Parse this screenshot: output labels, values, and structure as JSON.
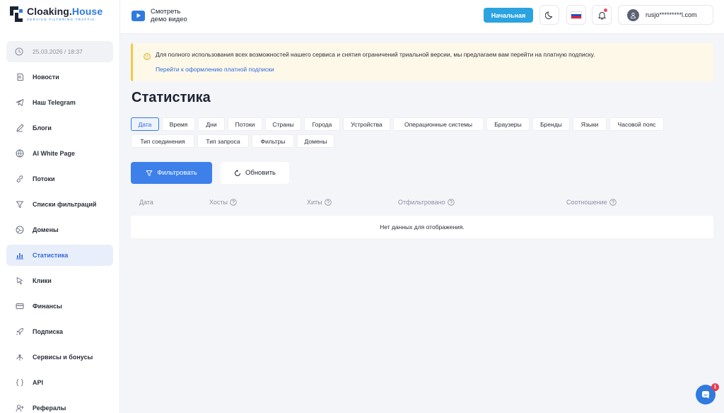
{
  "brand": {
    "name_part1": "Cloaking.",
    "name_part2": "House",
    "tagline": "SERVICE FILTERING TRAFFIC"
  },
  "sidebar": {
    "datetime": "25.03.2026 / 18:37",
    "items": [
      {
        "label": "Новости",
        "icon": "news-icon",
        "active": false
      },
      {
        "label": "Наш Telegram",
        "icon": "telegram-icon",
        "active": false
      },
      {
        "label": "Блоги",
        "icon": "pencil-icon",
        "active": false
      },
      {
        "label": "AI White Page",
        "icon": "globe-icon",
        "active": false
      },
      {
        "label": "Потоки",
        "icon": "link-icon",
        "active": false
      },
      {
        "label": "Списки фильтраций",
        "icon": "filter-icon",
        "active": false
      },
      {
        "label": "Домены",
        "icon": "globe-icon",
        "active": false
      },
      {
        "label": "Статистика",
        "icon": "bar-chart-icon",
        "active": true
      },
      {
        "label": "Клики",
        "icon": "cursor-icon",
        "active": false
      },
      {
        "label": "Финансы",
        "icon": "card-icon",
        "active": false
      },
      {
        "label": "Подписка",
        "icon": "rocket-icon",
        "active": false
      },
      {
        "label": "Сервисы и бонусы",
        "icon": "gift-icon",
        "active": false
      },
      {
        "label": "API",
        "icon": "braces-icon",
        "active": false
      },
      {
        "label": "Рефералы",
        "icon": "user-plus-icon",
        "active": false
      }
    ]
  },
  "header": {
    "demo_line1": "Смотреть",
    "demo_line2": "демо видео",
    "tariff_label": "Начальная",
    "user_email": "rusjo*********l.com"
  },
  "alert": {
    "message": "Для полного использования всех возможностей нашего сервиса и снятия ограничений триальной версии, мы предлагаем вам перейти на платную подписку.",
    "link": "Перейти к оформлению платной подписки"
  },
  "main": {
    "title": "Статистика",
    "tabs": [
      "Дата",
      "Время",
      "Дни",
      "Потоки",
      "Страны",
      "Города",
      "Устройства",
      "Операционные системы",
      "Браузеры",
      "Бренды",
      "Языки",
      "Часовой пояс",
      "Тип соединения",
      "Тип запроса",
      "Фильтры",
      "Домены"
    ],
    "active_tab": "Дата",
    "filter_button": "Фильтровать",
    "refresh_button": "Обновить",
    "columns": [
      "Дата",
      "Хосты",
      "Хиты",
      "Отфильтровано",
      "Соотношение"
    ],
    "empty_text": "Нет данных для отображения."
  },
  "chat": {
    "badge": "1"
  },
  "colors": {
    "accent": "#2f7be0",
    "tariff": "#2aa3e0",
    "alert_bg": "#fdf8e8",
    "alert_border": "#f2c94c",
    "badge": "#e83b4f"
  }
}
